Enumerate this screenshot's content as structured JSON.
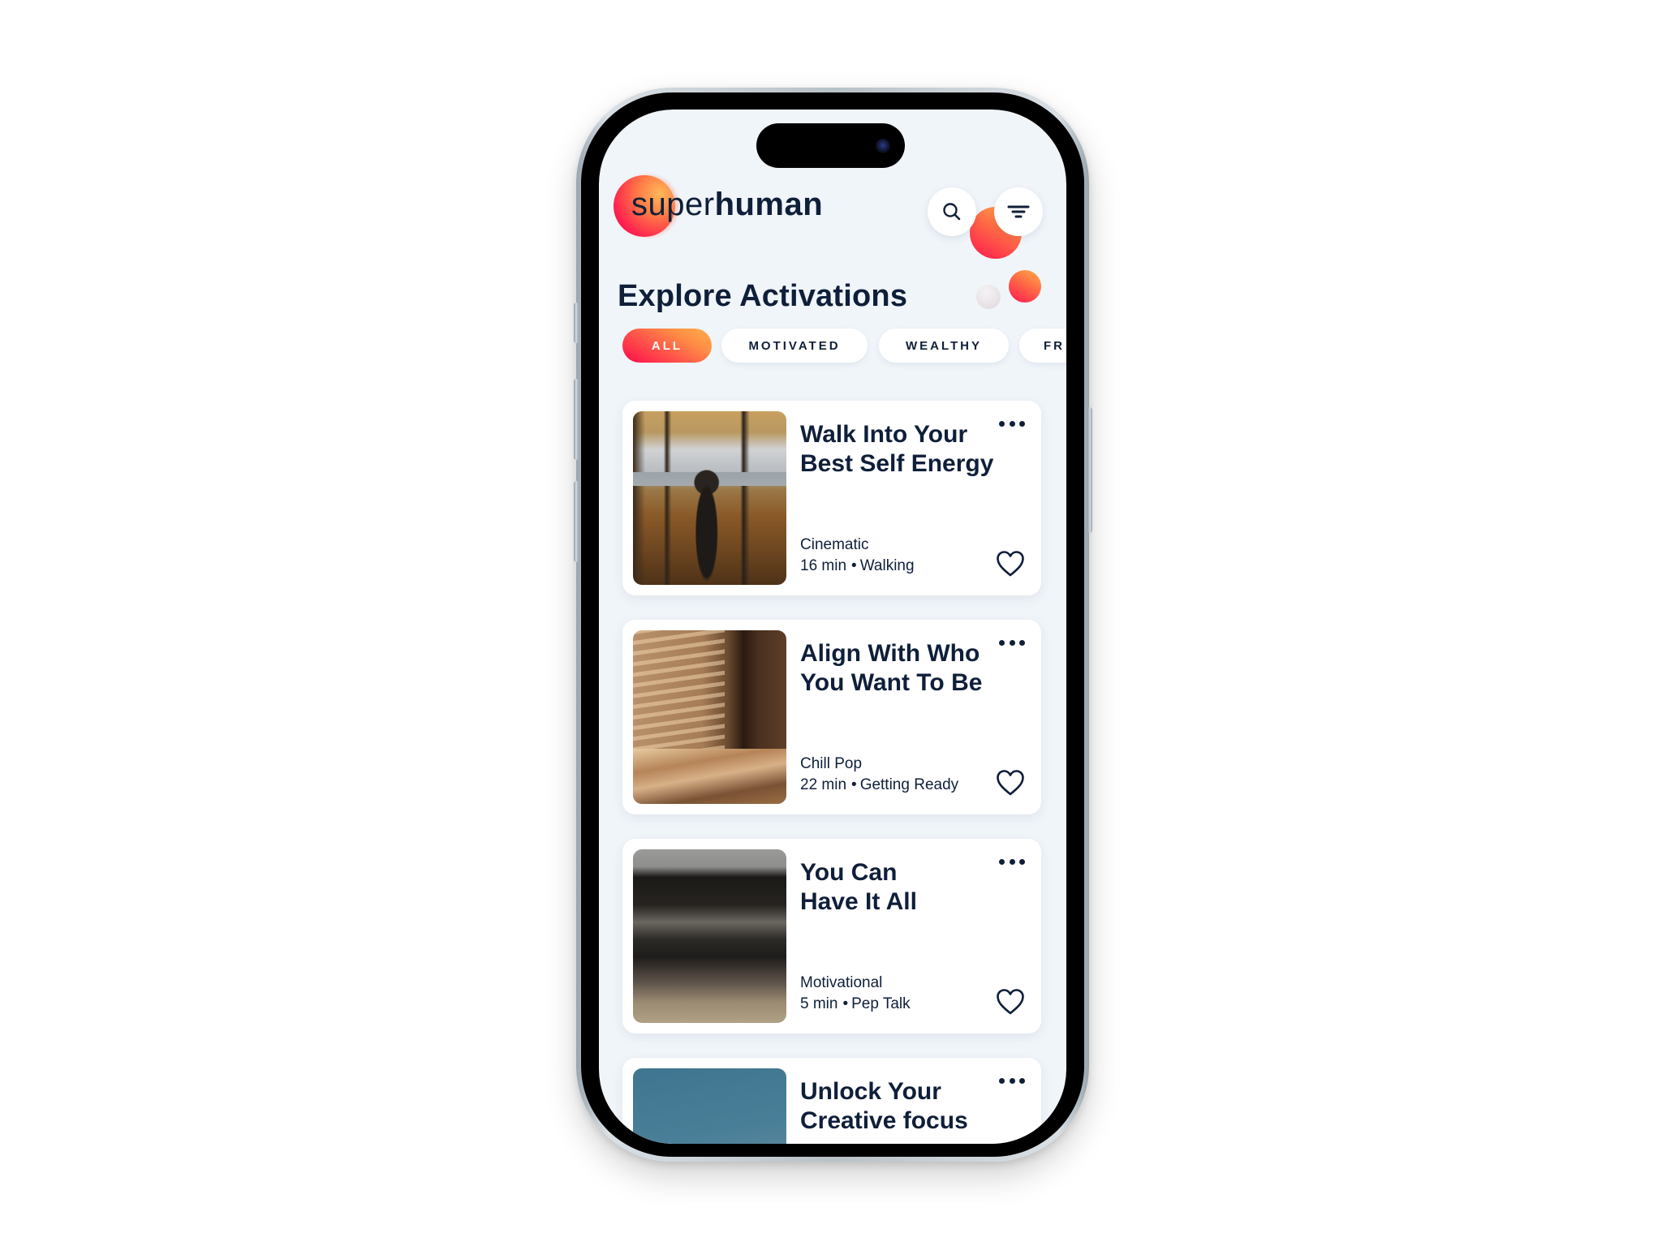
{
  "app": {
    "logo_light": "super",
    "logo_bold": "human",
    "search_icon": "search-icon",
    "filter_icon": "filter-icon"
  },
  "page": {
    "title": "Explore Activations"
  },
  "colors": {
    "background": "#f0f5fa",
    "text": "#0f1f3a",
    "accent_start": "#ff0a4a",
    "accent_end": "#ffb04a",
    "card": "#ffffff"
  },
  "filters": [
    {
      "label": "ALL",
      "active": true
    },
    {
      "label": "MOTIVATED",
      "active": false
    },
    {
      "label": "WEALTHY",
      "active": false
    },
    {
      "label": "FR",
      "active": false
    }
  ],
  "activations": [
    {
      "title": "Walk Into Your Best Self Energy",
      "genre": "Cinematic",
      "duration": "16 min",
      "category": "Walking",
      "favorited": false,
      "more_icon": "more-horizontal-icon",
      "heart_icon": "heart-outline-icon"
    },
    {
      "title": "Align With Who You Want To Be",
      "genre": "Chill Pop",
      "duration": "22 min",
      "category": "Getting Ready",
      "favorited": false,
      "more_icon": "more-horizontal-icon",
      "heart_icon": "heart-outline-icon"
    },
    {
      "title": "You Can Have It All",
      "genre": "Motivational",
      "duration": "5 min",
      "category": "Pep Talk",
      "favorited": false,
      "more_icon": "more-horizontal-icon",
      "heart_icon": "heart-outline-icon"
    },
    {
      "title": "Unlock Your Creative focus",
      "genre": "",
      "duration": "",
      "category": "",
      "favorited": false,
      "more_icon": "more-horizontal-icon",
      "heart_icon": "heart-outline-icon"
    }
  ],
  "separator": "•"
}
